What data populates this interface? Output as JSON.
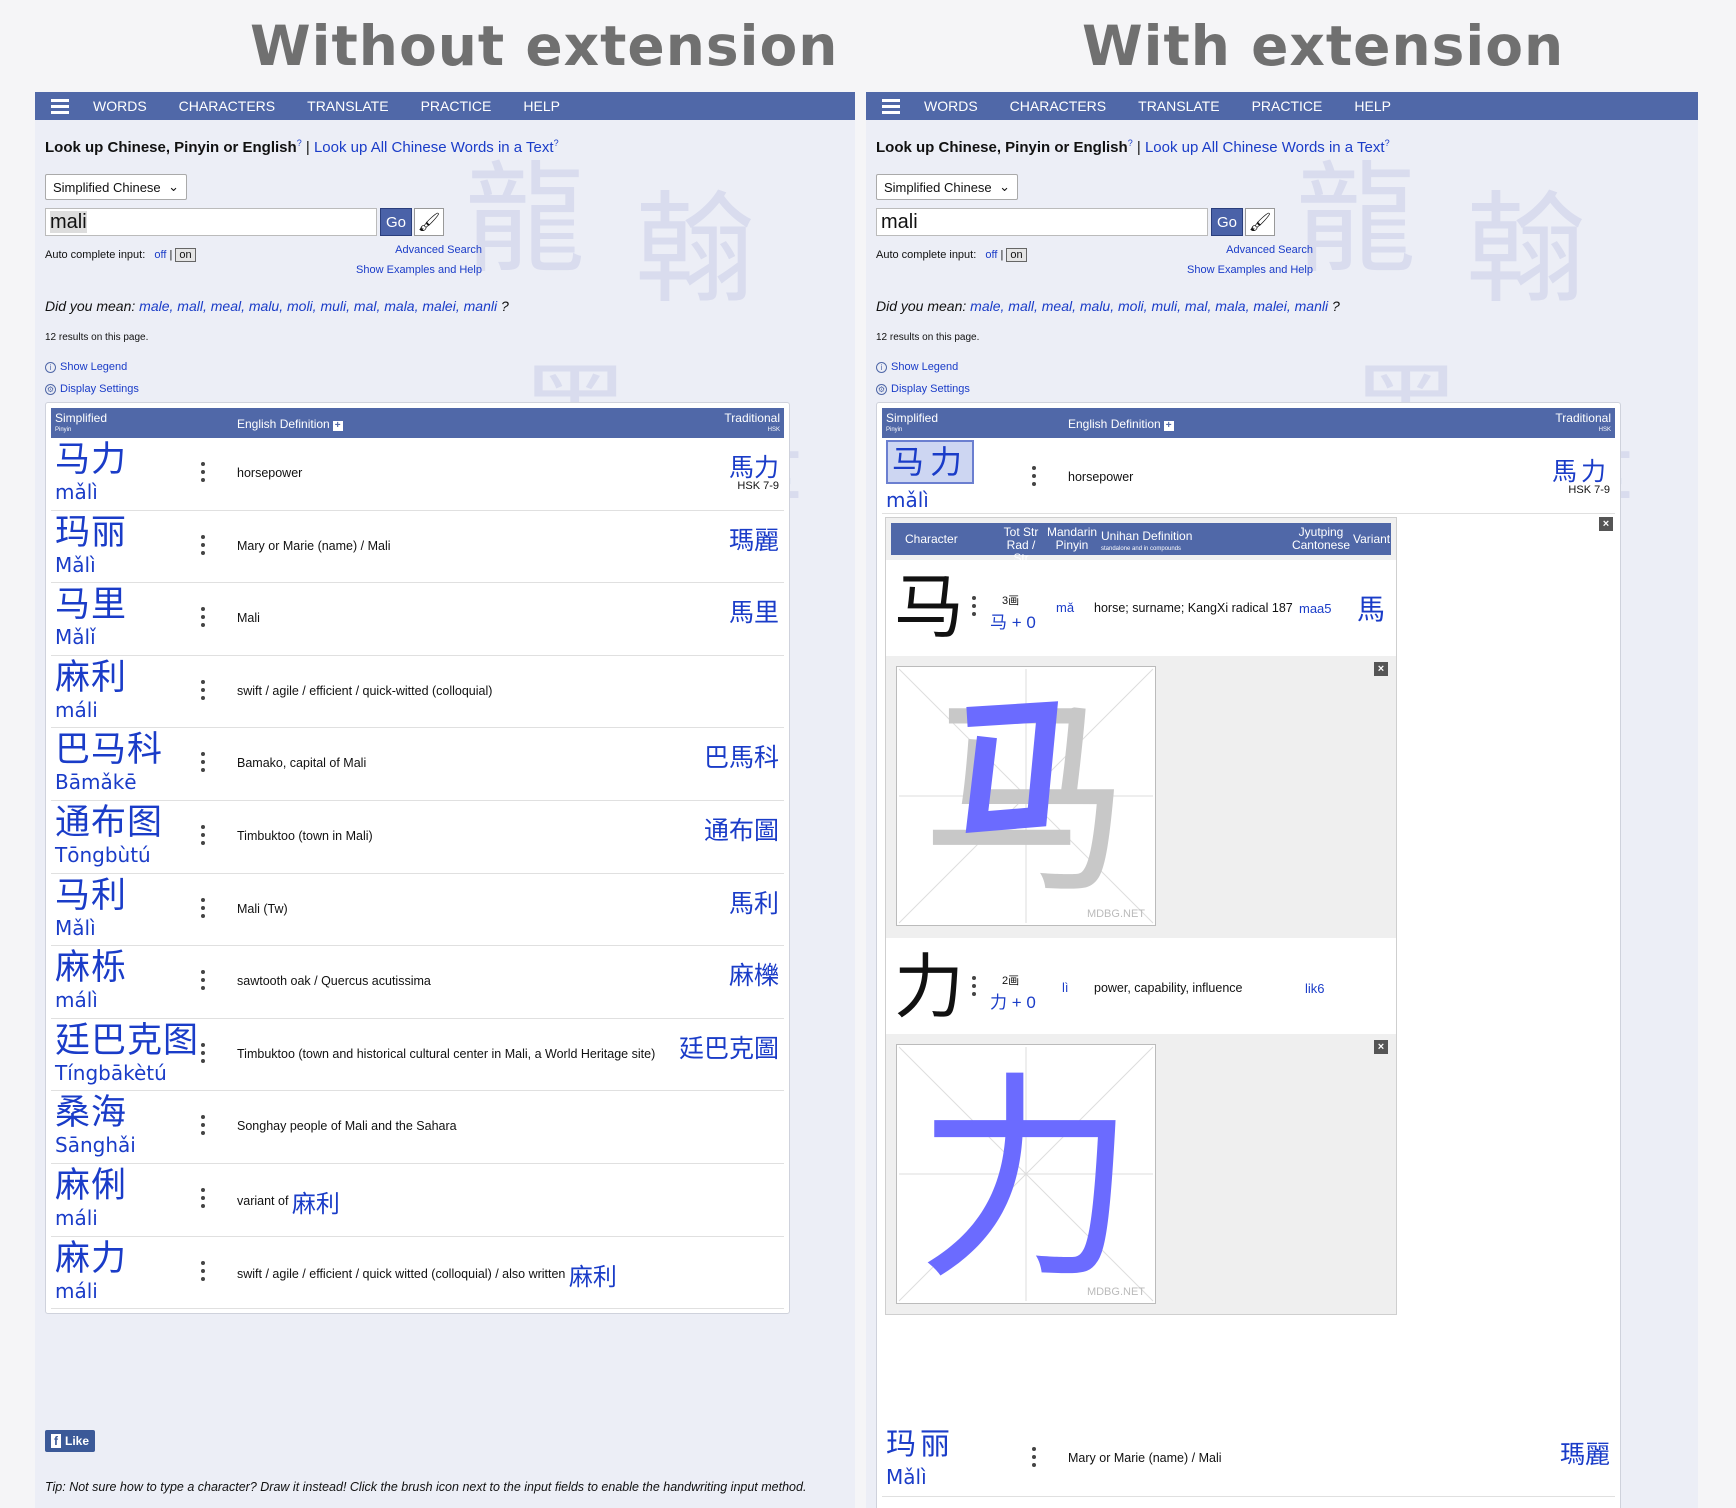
{
  "titles": {
    "left": "Without extension",
    "right": "With extension"
  },
  "nav": {
    "items": [
      "WORDS",
      "CHARACTERS",
      "TRANSLATE",
      "PRACTICE",
      "HELP"
    ]
  },
  "lookup": {
    "label": "Look up Chinese, Pinyin or English",
    "sup": "?",
    "sep": "|",
    "link": "Look up All Chinese Words in a Text",
    "link_sup": "?"
  },
  "language_select": "Simplified Chinese",
  "search": {
    "value": "mali",
    "go_label": "Go"
  },
  "autocomplete": {
    "label": "Auto complete input:",
    "off": "off",
    "sep": "|",
    "on": "on"
  },
  "advanced_search": "Advanced Search",
  "show_examples": "Show Examples and Help",
  "did_you_mean": {
    "label": "Did you mean:",
    "suggestions": [
      "male,",
      "mall,",
      "meal,",
      "malu,",
      "moli,",
      "muli,",
      "mal,",
      "mala,",
      "malei,",
      "manli"
    ],
    "end": "?"
  },
  "results_count": "12 results on this page.",
  "show_legend": "Show Legend",
  "display_settings": "Display Settings",
  "table_header": {
    "simplified": "Simplified",
    "pinyin": "Pinyin",
    "english": "English Definition",
    "traditional": "Traditional",
    "hsk": "HSK"
  },
  "results": [
    {
      "hz": "马力",
      "py": "mǎlì",
      "def": "horsepower",
      "trad": "馬力",
      "hsk": "HSK 7-9"
    },
    {
      "hz": "玛丽",
      "py": "Mǎlì",
      "def": "Mary or Marie (name) / Mali",
      "trad": "瑪麗",
      "hsk": ""
    },
    {
      "hz": "马里",
      "py": "Mǎlǐ",
      "def": "Mali",
      "trad": "馬里",
      "hsk": ""
    },
    {
      "hz": "麻利",
      "py": "máli",
      "def": "swift / agile / efficient / quick-witted (colloquial)",
      "trad": "",
      "hsk": ""
    },
    {
      "hz": "巴马科",
      "py": "Bāmǎkē",
      "def": "Bamako, capital of Mali",
      "trad": "巴馬科",
      "hsk": ""
    },
    {
      "hz": "通布图",
      "py": "Tōngbùtú",
      "def": "Timbuktoo (town in Mali)",
      "trad": "通布圖",
      "hsk": ""
    },
    {
      "hz": "马利",
      "py": "Mǎlì",
      "def": "Mali (Tw)",
      "trad": "馬利",
      "hsk": ""
    },
    {
      "hz": "麻栎",
      "py": "málì",
      "def": "sawtooth oak / Quercus acutissima",
      "trad": "麻櫟",
      "hsk": ""
    },
    {
      "hz": "廷巴克图",
      "py": "Tíngbākètú",
      "def": "Timbuktoo (town and historical cultural center in Mali, a World Heritage site)",
      "trad": "廷巴克圖",
      "hsk": ""
    },
    {
      "hz": "桑海",
      "py": "Sānghǎi",
      "def": "Songhay people of Mali and the Sahara",
      "trad": "",
      "hsk": ""
    },
    {
      "hz": "麻俐",
      "py": "máli",
      "def": "variant of",
      "def_link": "麻利",
      "trad": "",
      "hsk": ""
    },
    {
      "hz": "麻力",
      "py": "máli",
      "def": "swift / agile / efficient / quick witted (colloquial) / also written",
      "def_link": "麻利",
      "trad": "",
      "hsk": ""
    }
  ],
  "char_table": {
    "header": {
      "character": "Character",
      "tot_str": "Tot Str",
      "rad_str": "Rad / Str",
      "mandarin": "Mandarin",
      "pinyin": "Pinyin",
      "unihan": "Unihan Definition",
      "unihan_sub": "standalone and in compounds",
      "jyutping": "Jyutping",
      "cantonese": "Cantonese",
      "variant": "Variant"
    },
    "chars": [
      {
        "char": "马",
        "strokes": "3画",
        "radical": "马 + 0",
        "pinyin": "mǎ",
        "definition": "horse; surname; KangXi radical 187",
        "jyutping": "maa5",
        "variant": "馬"
      },
      {
        "char": "力",
        "strokes": "2画",
        "radical": "力 + 0",
        "pinyin": "lì",
        "definition": "power, capability, influence",
        "jyutping": "lik6",
        "variant": ""
      }
    ],
    "watermark": "MDBG.NET"
  },
  "fb_like": "Like",
  "tip": "Tip: Not sure how to type a character? Draw it instead! Click the brush icon next to the input fields to enable the handwriting input method.",
  "colors": {
    "nav": "#5068a8",
    "link": "#1a3cc8",
    "stroke_done": "#6b6bff",
    "stroke_pending": "#c8c8c8"
  }
}
